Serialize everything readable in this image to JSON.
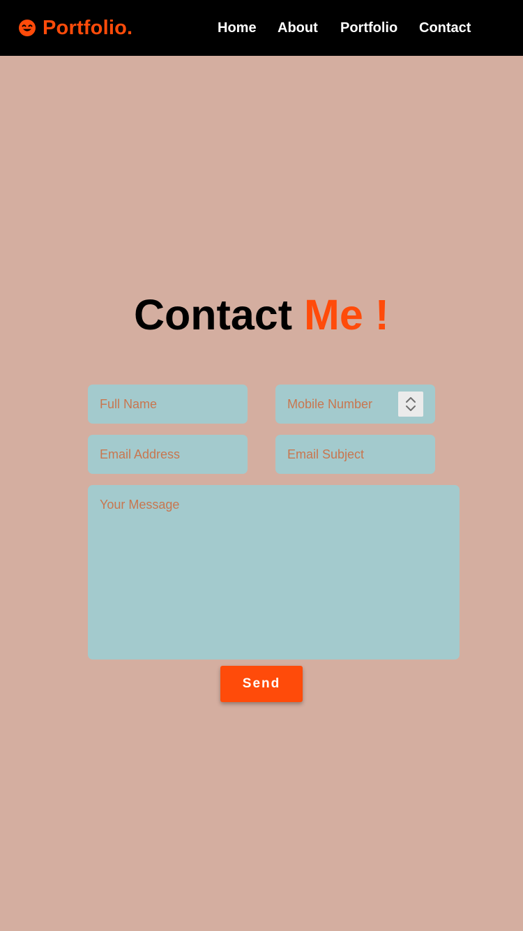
{
  "brand": {
    "icon": "smiley-face-icon",
    "name": "Portfolio."
  },
  "nav": {
    "home": "Home",
    "about": "About",
    "portfolio": "Portfolio",
    "contact": "Contact"
  },
  "heading": {
    "main": "Contact",
    "accent": "Me !"
  },
  "form": {
    "full_name_placeholder": "Full Name",
    "mobile_placeholder": "Mobile Number",
    "email_placeholder": "Email Address",
    "subject_placeholder": "Email Subject",
    "message_placeholder": "Your Message",
    "send_label": "Send"
  },
  "colors": {
    "accent": "#ff4b0a",
    "background": "#d4aea0",
    "navbar": "#000000",
    "field": "#a3cacd",
    "placeholder": "#c8764f"
  }
}
